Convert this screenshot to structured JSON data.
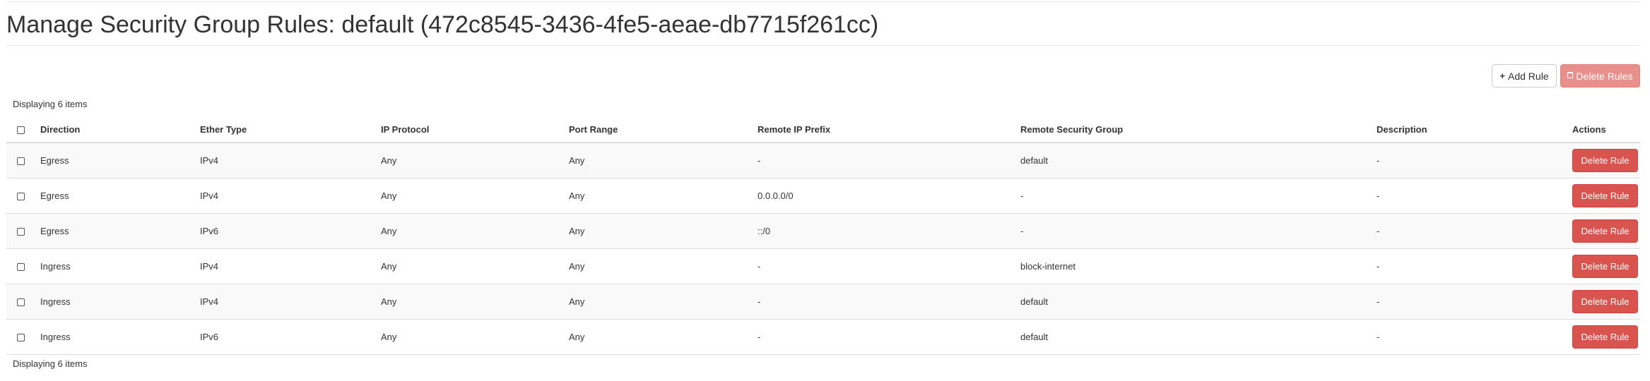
{
  "page": {
    "title": "Manage Security Group Rules: default (472c8545-3436-4fe5-aeae-db7715f261cc)"
  },
  "toolbar": {
    "add_rule_label": "Add Rule",
    "delete_rules_label": "Delete Rules"
  },
  "table": {
    "count_text": "Displaying 6 items",
    "columns": {
      "direction": "Direction",
      "ether_type": "Ether Type",
      "ip_protocol": "IP Protocol",
      "port_range": "Port Range",
      "remote_ip_prefix": "Remote IP Prefix",
      "remote_security_group": "Remote Security Group",
      "description": "Description",
      "actions": "Actions"
    },
    "rows": [
      {
        "direction": "Egress",
        "ether_type": "IPv4",
        "ip_protocol": "Any",
        "port_range": "Any",
        "remote_ip_prefix": "-",
        "remote_security_group": "default",
        "description": "-",
        "action_label": "Delete Rule"
      },
      {
        "direction": "Egress",
        "ether_type": "IPv4",
        "ip_protocol": "Any",
        "port_range": "Any",
        "remote_ip_prefix": "0.0.0.0/0",
        "remote_security_group": "-",
        "description": "-",
        "action_label": "Delete Rule"
      },
      {
        "direction": "Egress",
        "ether_type": "IPv6",
        "ip_protocol": "Any",
        "port_range": "Any",
        "remote_ip_prefix": "::/0",
        "remote_security_group": "-",
        "description": "-",
        "action_label": "Delete Rule"
      },
      {
        "direction": "Ingress",
        "ether_type": "IPv4",
        "ip_protocol": "Any",
        "port_range": "Any",
        "remote_ip_prefix": "-",
        "remote_security_group": "block-internet",
        "description": "-",
        "action_label": "Delete Rule"
      },
      {
        "direction": "Ingress",
        "ether_type": "IPv4",
        "ip_protocol": "Any",
        "port_range": "Any",
        "remote_ip_prefix": "-",
        "remote_security_group": "default",
        "description": "-",
        "action_label": "Delete Rule"
      },
      {
        "direction": "Ingress",
        "ether_type": "IPv6",
        "ip_protocol": "Any",
        "port_range": "Any",
        "remote_ip_prefix": "-",
        "remote_security_group": "default",
        "description": "-",
        "action_label": "Delete Rule"
      }
    ]
  },
  "colors": {
    "danger": "#d9534f",
    "danger_disabled": "#e9908d",
    "row_stripe": "#f9f9f9",
    "border": "#dddddd"
  },
  "icons": {
    "add": "plus-icon",
    "delete": "trash-icon"
  }
}
